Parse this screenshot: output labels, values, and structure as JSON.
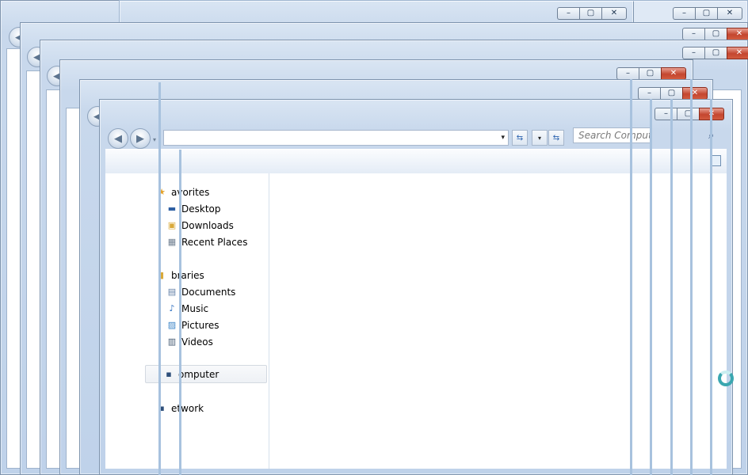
{
  "windows": [
    {
      "id": "w1",
      "controls": [
        "–",
        "▢",
        "✕"
      ],
      "close_style": "pale"
    },
    {
      "id": "w2",
      "controls": [
        "–",
        "▢",
        "✕"
      ],
      "close_style": "pale"
    },
    {
      "id": "w3",
      "controls": [
        "–",
        "▢",
        "✕"
      ],
      "close_style": "red"
    },
    {
      "id": "w4",
      "controls": [
        "–",
        "▢",
        "✕"
      ],
      "close_style": "red"
    },
    {
      "id": "w5",
      "controls": [
        "–",
        "▢",
        "✕"
      ],
      "close_style": "red"
    },
    {
      "id": "w6",
      "controls": [
        "–",
        "▢",
        "✕"
      ],
      "close_style": "red"
    },
    {
      "id": "w7",
      "controls": [
        "–",
        "▢",
        "✕"
      ],
      "close_style": "red"
    }
  ],
  "explorer": {
    "search_placeholder": "Search Compute",
    "address_dropdown": "▾",
    "refresh_icon": "⇆",
    "nav": {
      "favorites_label": "avorites",
      "favorites_items": [
        {
          "label": "Desktop",
          "icon": "desktop-icon",
          "glyph": "▬"
        },
        {
          "label": "Downloads",
          "icon": "downloads-icon",
          "glyph": "▣"
        },
        {
          "label": "Recent Places",
          "icon": "recent-places-icon",
          "glyph": "▦"
        }
      ],
      "libraries_label": "braries",
      "libraries_items": [
        {
          "label": "Documents",
          "icon": "documents-icon",
          "glyph": "▤"
        },
        {
          "label": "Music",
          "icon": "music-icon",
          "glyph": "♪"
        },
        {
          "label": "Pictures",
          "icon": "pictures-icon",
          "glyph": "▨"
        },
        {
          "label": "Videos",
          "icon": "videos-icon",
          "glyph": "▥"
        }
      ],
      "computer_label": "omputer",
      "network_label": "etwork"
    }
  },
  "colors": {
    "frame": "#c8d8ec",
    "close_red": "#c4462f",
    "selection": "#eef1f5",
    "busy_ring": "#3aa7b0"
  }
}
